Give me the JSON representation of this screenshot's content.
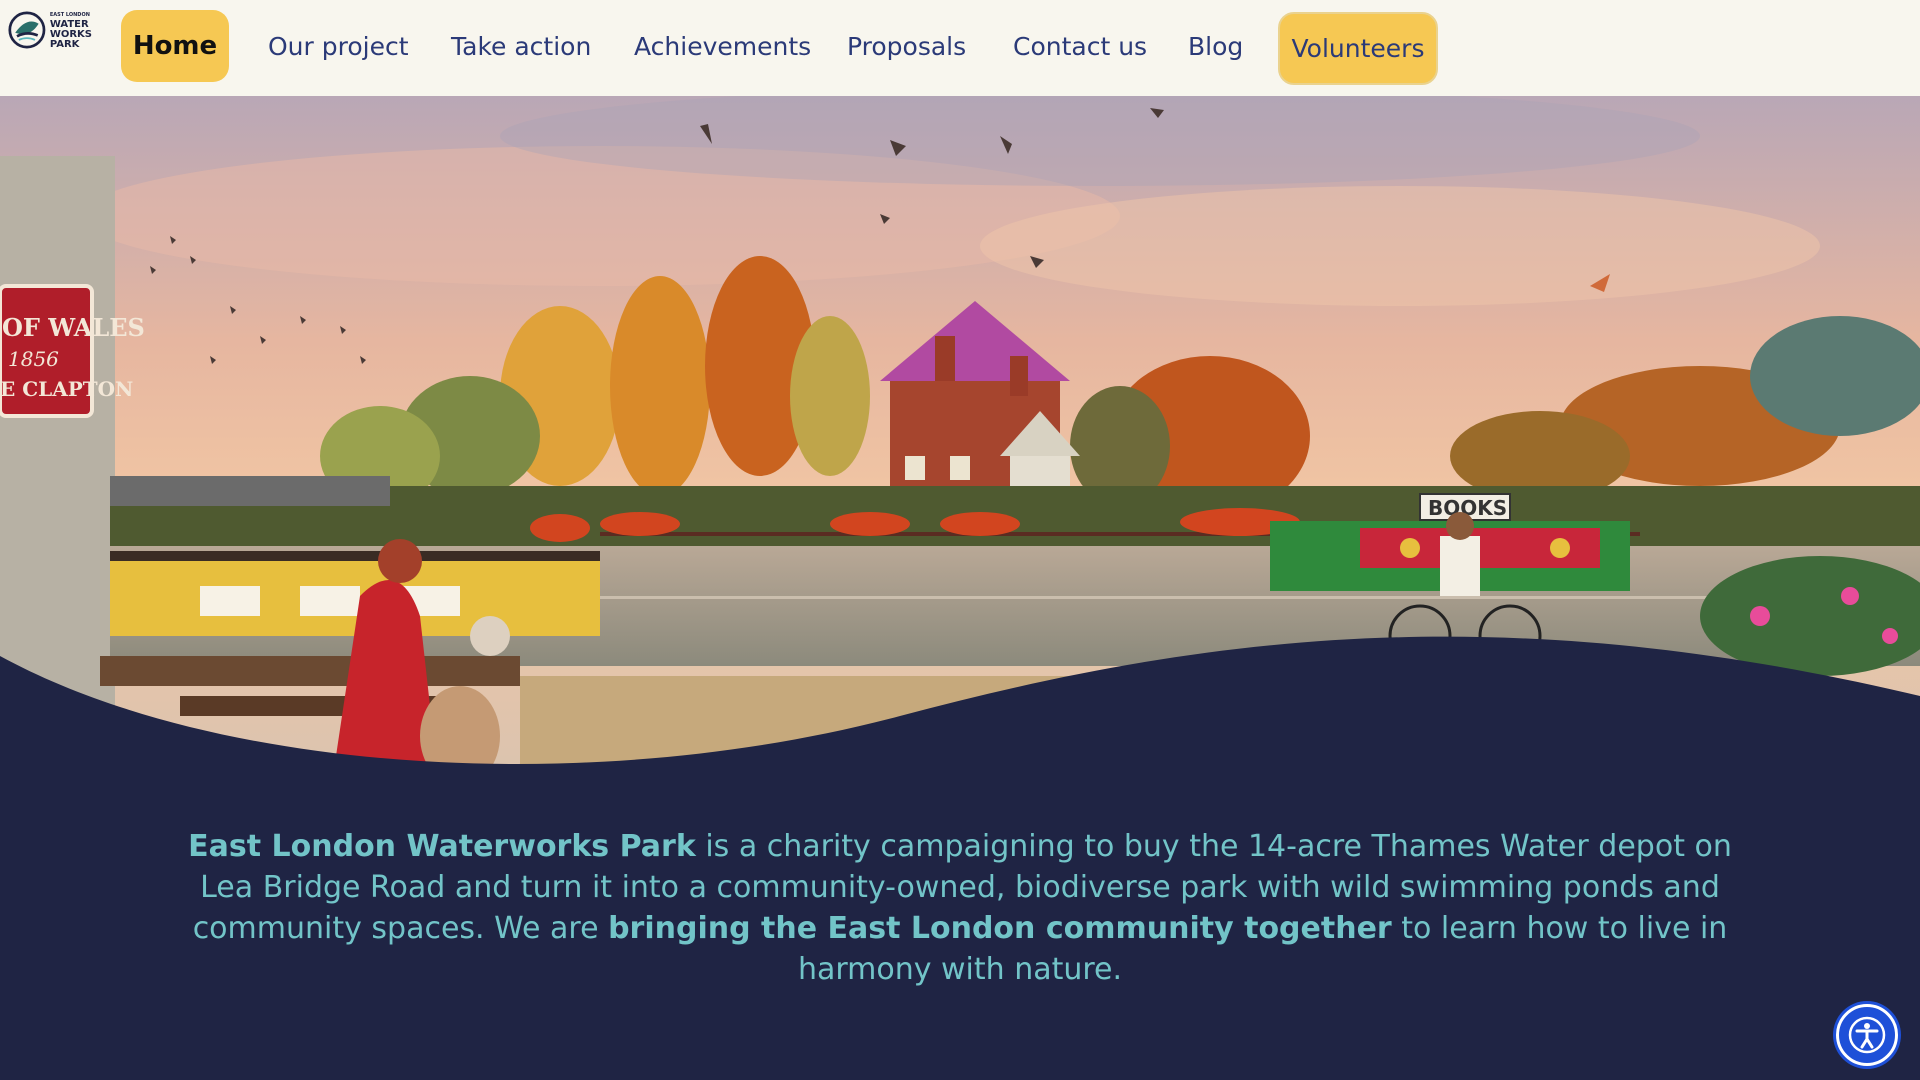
{
  "logo": {
    "line1": "EAST LONDON",
    "line2": "WATER",
    "line3": "WORKS",
    "line4": "PARK",
    "icon": "leaf-water-logo"
  },
  "nav": {
    "home": "Home",
    "our_project": "Our project",
    "take_action": "Take action",
    "achievements": "Achievements",
    "proposals": "Proposals",
    "contact_us": "Contact us",
    "blog": "Blog",
    "volunteers": "Volunteers"
  },
  "hero": {
    "sign_line1": "OF WALES",
    "sign_line2": "1856",
    "sign_line3": "E CLAPTON",
    "boat_sign": "BOOKS"
  },
  "intro": {
    "bold1": "East London Waterworks Park",
    "text1": " is a charity campaigning to buy the 14-acre Thames Water depot on Lea Bridge Road and turn it into a community-owned, biodiverse park with wild swimming ponds and community spaces. We are ",
    "bold2": "bringing the East London community together",
    "text2": " to learn how to live in harmony with nature."
  },
  "colors": {
    "header_bg": "#f8f6ee",
    "accent_yellow": "#f6c853",
    "nav_text": "#2b3a78",
    "footer_bg": "#1f2444",
    "intro_text": "#72c4c8",
    "a11y_blue": "#1e50d8"
  },
  "accessibility": {
    "icon": "accessibility-icon"
  }
}
